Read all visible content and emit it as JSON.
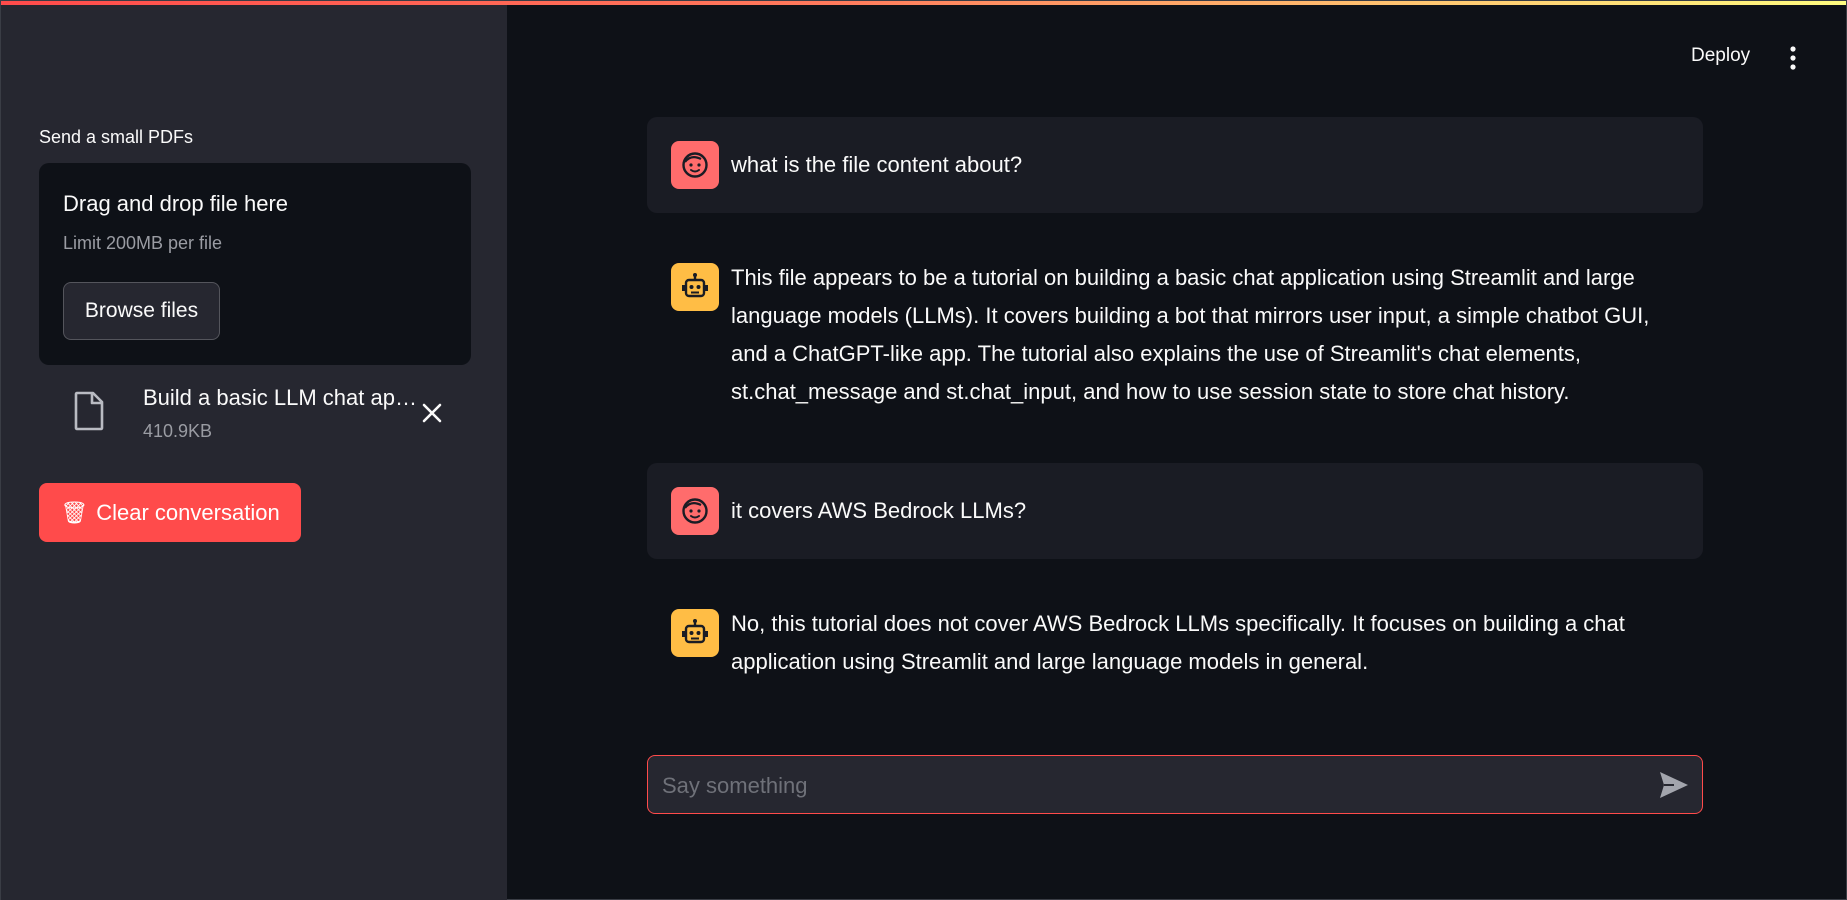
{
  "sidebar": {
    "uploader_label": "Send a small PDFs",
    "dropzone": {
      "title": "Drag and drop file here",
      "limit": "Limit 200MB per file",
      "browse_label": "Browse files"
    },
    "file": {
      "name": "Build a basic LLM chat app with Streamlit.pdf",
      "size": "410.9KB"
    },
    "clear_label": "Clear conversation",
    "clear_icon": "wastebasket-emoji"
  },
  "header": {
    "deploy_label": "Deploy"
  },
  "messages": [
    {
      "role": "user",
      "text": "what is the file content about?"
    },
    {
      "role": "assistant",
      "text": "This file appears to be a tutorial on building a basic chat application using Streamlit and large language models (LLMs). It covers building a bot that mirrors user input, a simple chatbot GUI, and a ChatGPT-like app. The tutorial also explains the use of Streamlit's chat elements, st.chat_message and st.chat_input, and how to use session state to store chat history."
    },
    {
      "role": "user",
      "text": "it covers AWS Bedrock LLMs?"
    },
    {
      "role": "assistant",
      "text": "No, this tutorial does not cover AWS Bedrock LLMs specifically. It focuses on building a chat application using Streamlit and large language models in general."
    }
  ],
  "chat_input": {
    "placeholder": "Say something",
    "value": ""
  },
  "colors": {
    "primary": "#ff4b4b",
    "background": "#0e1117",
    "sidebar_bg": "#262730",
    "user_avatar": "#ff6c6c",
    "assistant_avatar": "#ffbd45"
  }
}
